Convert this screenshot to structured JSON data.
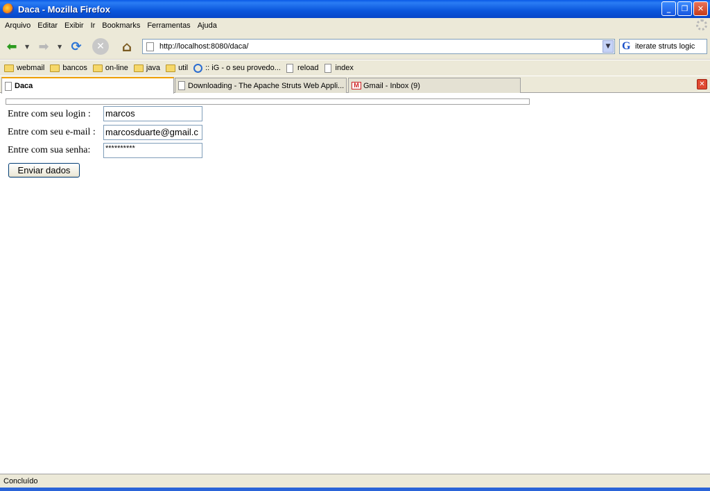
{
  "window": {
    "title": "Daca - Mozilla Firefox",
    "minimize": "_",
    "restore": "❐",
    "close": "✕"
  },
  "menu": [
    "Arquivo",
    "Editar",
    "Exibir",
    "Ir",
    "Bookmarks",
    "Ferramentas",
    "Ajuda"
  ],
  "navigation": {
    "url": "http://localhost:8080/daca/",
    "search_text": "iterate struts logic"
  },
  "bookmarks": [
    {
      "label": "webmail",
      "icon": "folder-icon"
    },
    {
      "label": "bancos",
      "icon": "folder-icon"
    },
    {
      "label": "on-line",
      "icon": "folder-icon"
    },
    {
      "label": "java",
      "icon": "folder-icon"
    },
    {
      "label": "util",
      "icon": "folder-icon"
    },
    {
      "label": ":: iG - o seu provedo...",
      "icon": "ie-icon"
    },
    {
      "label": "reload",
      "icon": "page-icon"
    },
    {
      "label": "index",
      "icon": "page-icon"
    }
  ],
  "tabs": [
    {
      "label": "Daca",
      "active": true
    },
    {
      "label": "Downloading - The Apache Struts Web Appli...",
      "active": false
    },
    {
      "label": "Gmail - Inbox (9)",
      "active": false
    }
  ],
  "form": {
    "login_label": "Entre com seu login :",
    "login_value": "marcos",
    "email_label": "Entre com seu e-mail :",
    "email_value": "marcosduarte@gmail.c",
    "password_label": "Entre com sua senha:",
    "password_value": "**********",
    "submit_label": "Enviar dados"
  },
  "status": {
    "text": "Concluído"
  }
}
